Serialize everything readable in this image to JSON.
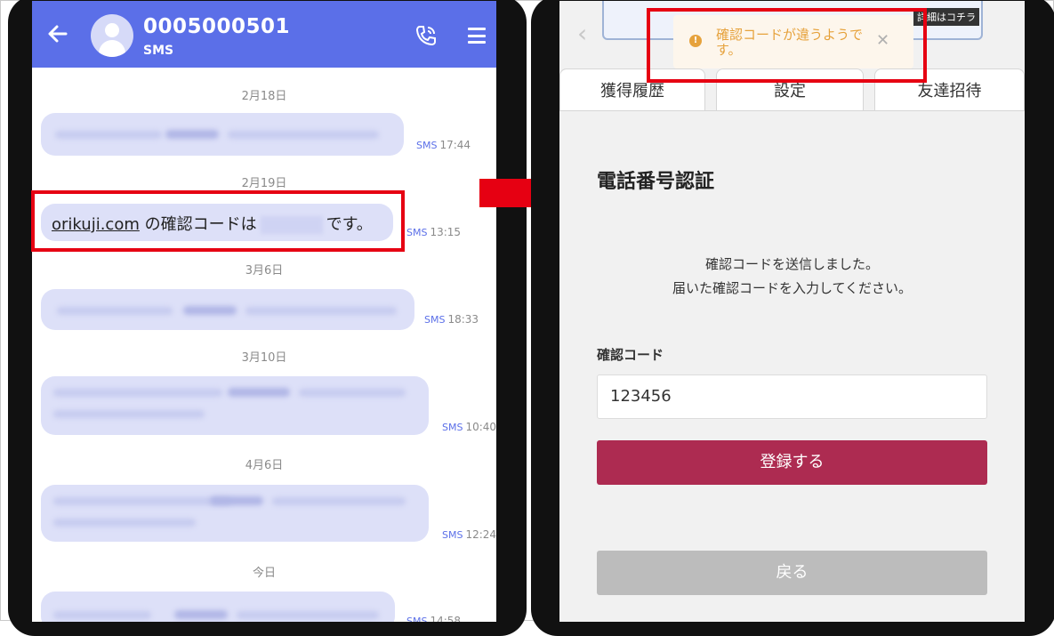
{
  "left": {
    "contact_name": "0005000501",
    "contact_sub": "SMS",
    "dates": [
      "2月18日",
      "2月19日",
      "3月6日",
      "3月10日",
      "4月6日",
      "今日"
    ],
    "sms_tag": "SMS",
    "times": [
      "17:44",
      "13:15",
      "18:33",
      "10:40",
      "12:24",
      "14:58"
    ],
    "code_message": {
      "link": "orikuji.com",
      "before_code": " の確認コードは",
      "after_code": "です。"
    }
  },
  "right": {
    "banner_tag": "詳細はコチラ",
    "tabs": [
      "獲得履歴",
      "設定",
      "友達招待"
    ],
    "toast": {
      "message": "確認コードが違うようです。",
      "icon": "warning-icon"
    },
    "heading": "電話番号認証",
    "info_line1": "確認コードを送信しました。",
    "info_line2": "届いた確認コードを入力してください。",
    "code_label": "確認コード",
    "code_value": "123456",
    "register_button": "登録する",
    "back_button": "戻る"
  },
  "colors": {
    "header": "#5b6fe8",
    "highlight": "#e60012",
    "register": "#ad2b51",
    "toast_text": "#e6a23c"
  }
}
